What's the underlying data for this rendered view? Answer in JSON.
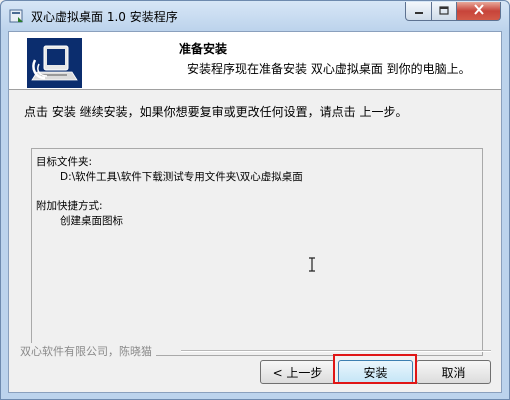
{
  "window": {
    "title": "双心虚拟桌面 1.0 安装程序",
    "icon": "installer-app-icon",
    "controls": {
      "minimize_icon": "minimize-icon",
      "maximize_icon": "maximize-icon",
      "close_icon": "close-icon"
    }
  },
  "header": {
    "title": "准备安装",
    "subtitle": "安装程序现在准备安装 双心虚拟桌面 到你的电脑上。",
    "logo_icon": "computer-install-logo-icon"
  },
  "instruction": "点击 安装 继续安装，如果你想要复审或更改任何设置，请点击 上一步。",
  "memo": {
    "dest_label": "目标文件夹:",
    "dest_path": "D:\\软件工具\\软件下载测试专用文件夹\\双心虚拟桌面",
    "shortcut_label": "附加快捷方式:",
    "shortcut_item": "创建桌面图标",
    "cursor_icon": "text-cursor-icon"
  },
  "brand": "双心软件有限公司，陈晓猫",
  "buttons": {
    "back": "< 上一步",
    "install": "安装",
    "cancel": "取消"
  },
  "colors": {
    "highlight": "#e01515",
    "logo_bg": "#0b2d6e",
    "title_bar": "#bcd3ec"
  }
}
